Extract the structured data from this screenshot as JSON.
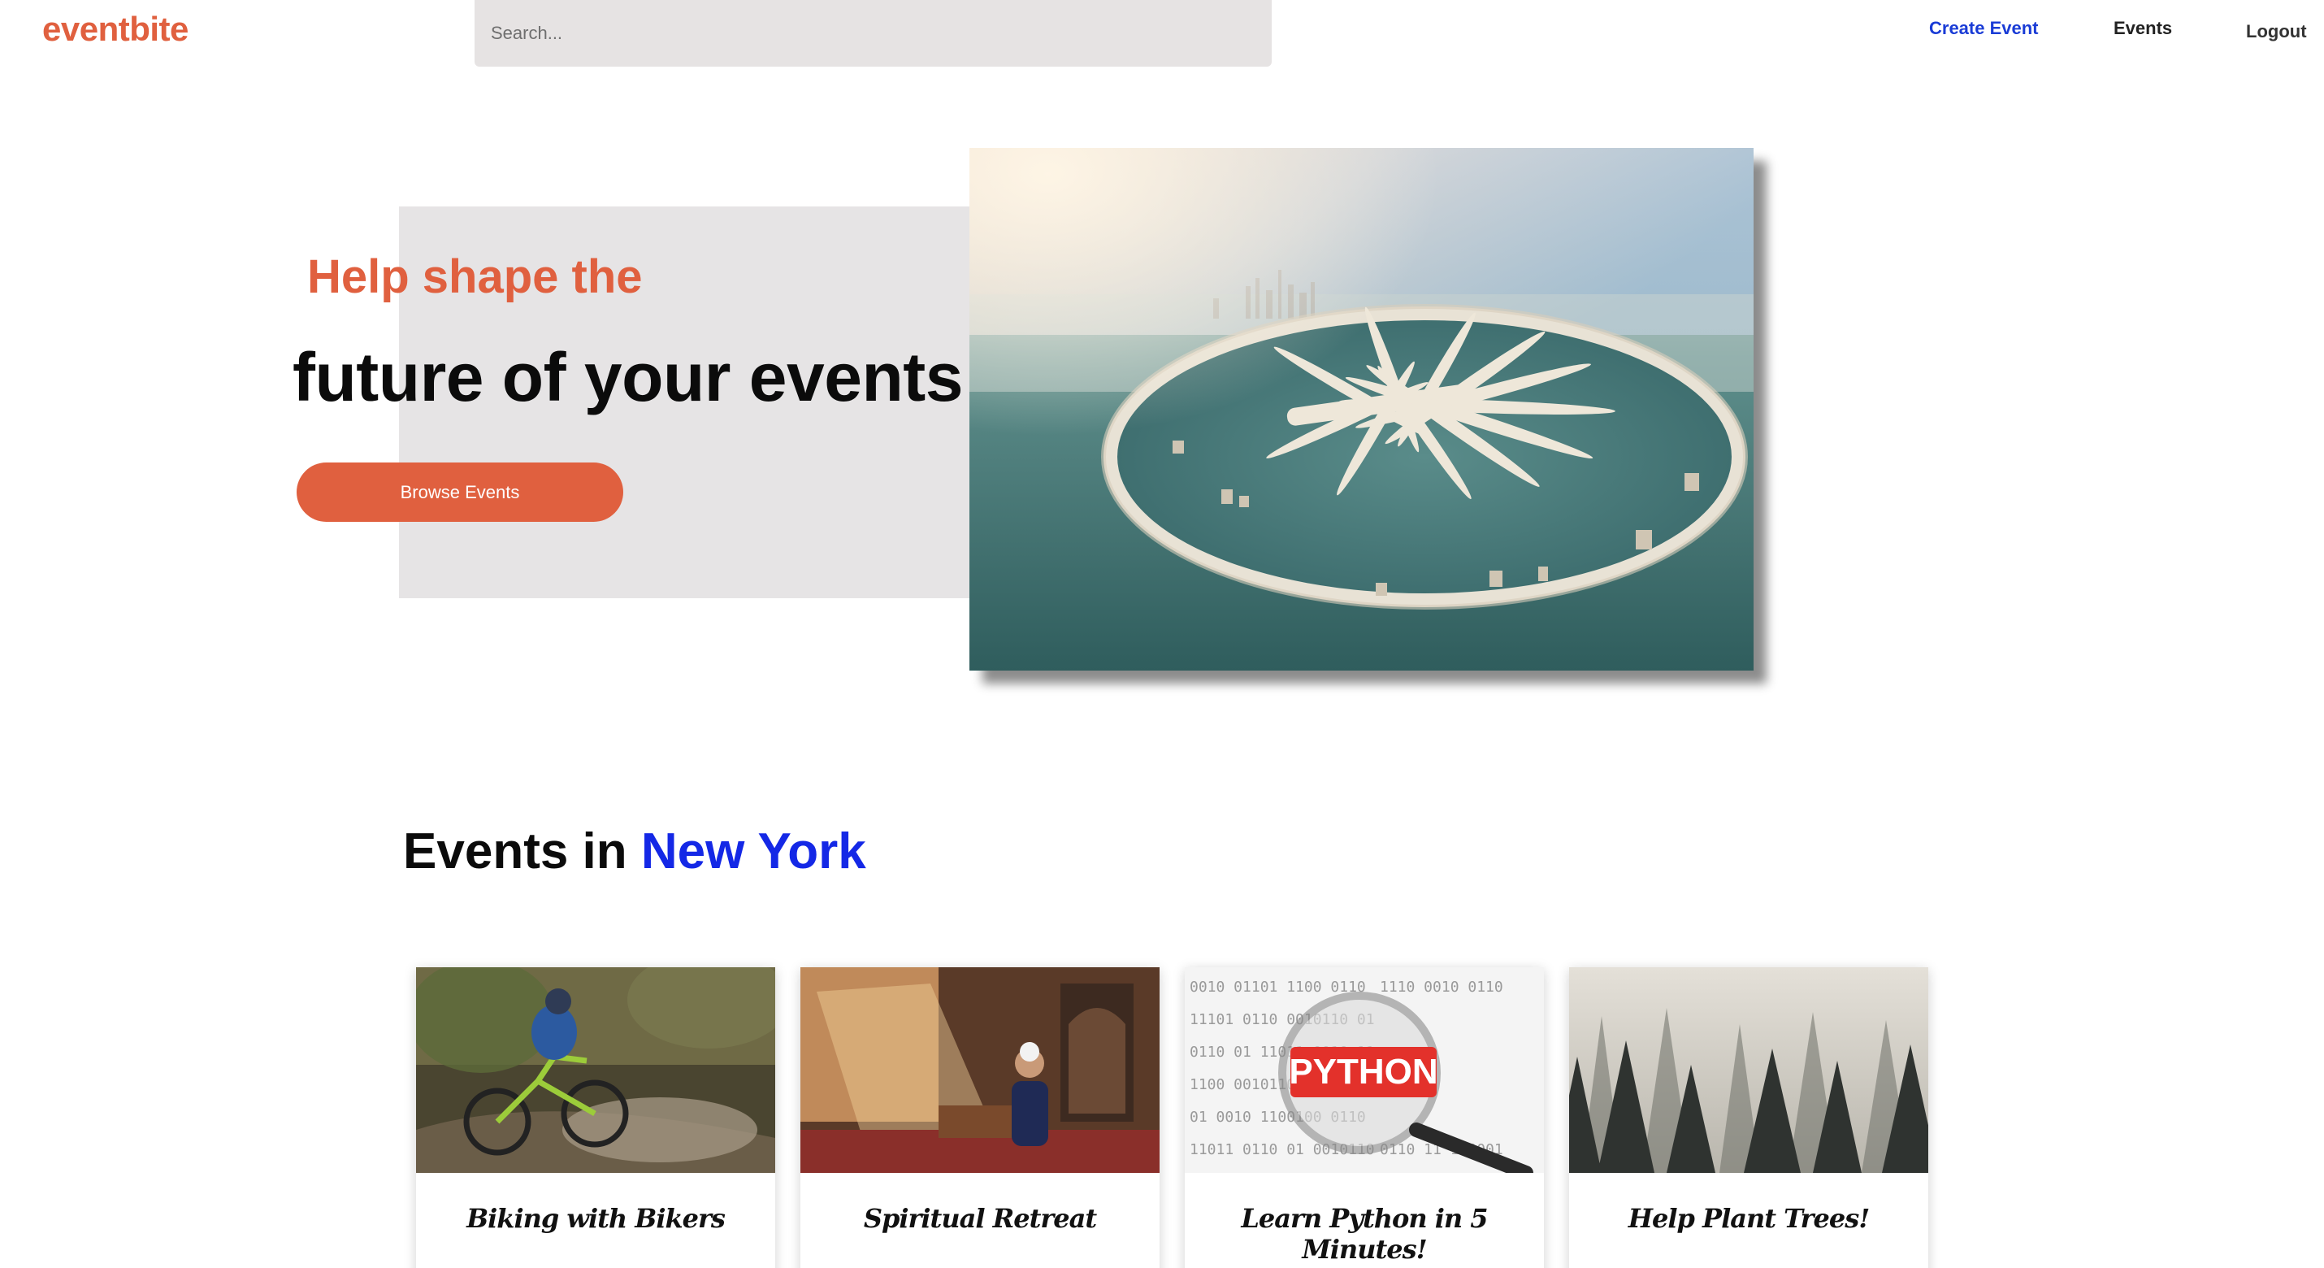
{
  "header": {
    "logo": "eventbite",
    "search_placeholder": "Search...",
    "nav": {
      "create_event": "Create Event",
      "events": "Events",
      "logout": "Logout"
    }
  },
  "hero": {
    "subtitle": "Help shape the",
    "title": "future of your events",
    "cta": "Browse Events"
  },
  "section": {
    "title_prefix": "Events in",
    "city": "New York"
  },
  "events": [
    {
      "title": "Biking with Bikers"
    },
    {
      "title": "Spiritual Retreat"
    },
    {
      "title": "Learn Python in 5 Minutes!",
      "image_text": "PYTHON"
    },
    {
      "title": "Help Plant Trees!"
    }
  ],
  "colors": {
    "brand": "#e0603f",
    "link": "#1a3cd6",
    "city": "#1428e6",
    "search_bg": "#e6e3e3",
    "hero_box": "#e6e4e5"
  }
}
